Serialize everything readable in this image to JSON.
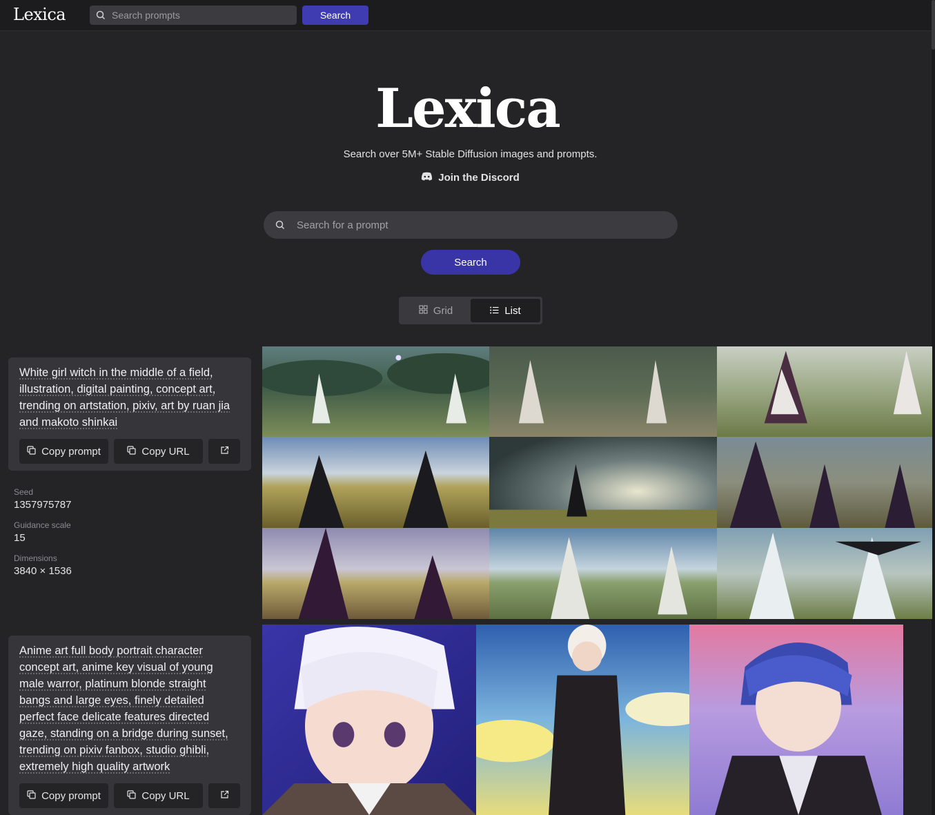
{
  "nav": {
    "brand": "Lexica",
    "search_placeholder": "Search prompts",
    "search_button": "Search"
  },
  "hero": {
    "title": "Lexica",
    "subtitle": "Search over 5M+ Stable Diffusion images and prompts.",
    "discord_label": "Join the Discord",
    "search_placeholder": "Search for a prompt",
    "search_button": "Search"
  },
  "view_toggle": {
    "grid_label": "Grid",
    "list_label": "List",
    "selected": "List"
  },
  "results": [
    {
      "prompt": "White girl witch in the middle of a field, illustration, digital painting, concept art, trending on artstation, pixiv, art by ruan jia and makoto shinkai",
      "copy_prompt_label": "Copy prompt",
      "copy_url_label": "Copy URL",
      "seed_label": "Seed",
      "seed": "1357975787",
      "guidance_label": "Guidance scale",
      "guidance": "15",
      "dimensions_label": "Dimensions",
      "dimensions": "3840 × 1536",
      "image_count": 9
    },
    {
      "prompt": "Anime art full body portrait character concept art, anime key visual of young male warror, platinum blonde straight bangs and large eyes, finely detailed perfect face delicate features directed gaze, standing on a bridge during sunset, trending on pixiv fanbox, studio ghibli, extremely high quality artwork",
      "copy_prompt_label": "Copy prompt",
      "copy_url_label": "Copy URL",
      "image_count": 3
    }
  ],
  "colors": {
    "background": "#242427",
    "topbar": "#1c1c1e",
    "accent": "#3f3bb0",
    "card": "#36363a"
  },
  "icons": [
    "search-icon",
    "discord-icon",
    "grid-icon",
    "list-icon",
    "copy-icon",
    "external-link-icon"
  ]
}
